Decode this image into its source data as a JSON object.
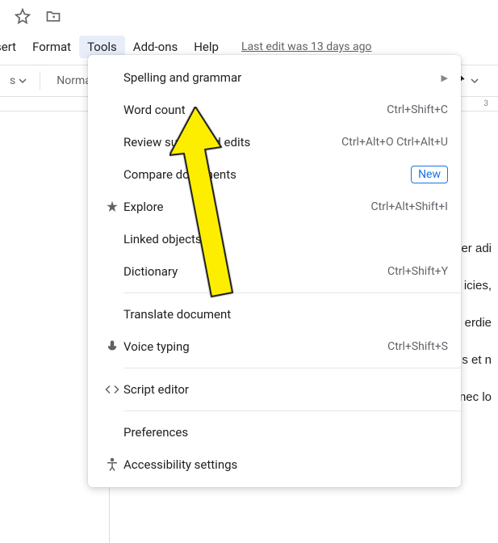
{
  "topIcons": {
    "star": "star-outline",
    "folder": "move-folder"
  },
  "menubar": {
    "items": [
      "sert",
      "Format",
      "Tools",
      "Add-ons",
      "Help"
    ],
    "activeIndex": 2,
    "lastEdit": "Last edit was 13 days ago"
  },
  "toolbar": {
    "styleDropdown": "Normal"
  },
  "ruler": {
    "marks": [
      "3"
    ]
  },
  "toolsMenu": {
    "items": [
      {
        "label": "Spelling and grammar",
        "icon": "",
        "shortcut": "",
        "submenu": true
      },
      {
        "label": "Word count",
        "icon": "",
        "shortcut": "Ctrl+Shift+C"
      },
      {
        "label": "Review suggested edits",
        "icon": "",
        "shortcut": "Ctrl+Alt+O Ctrl+Alt+U"
      },
      {
        "label": "Compare documents",
        "icon": "",
        "badge": "New"
      },
      {
        "label": "Explore",
        "icon": "explore",
        "shortcut": "Ctrl+Alt+Shift+I"
      },
      {
        "label": "Linked objects",
        "icon": ""
      },
      {
        "label": "Dictionary",
        "icon": "",
        "shortcut": "Ctrl+Shift+Y"
      },
      {
        "separator": true
      },
      {
        "label": "Translate document",
        "icon": ""
      },
      {
        "label": "Voice typing",
        "icon": "mic",
        "shortcut": "Ctrl+Shift+S"
      },
      {
        "separator": true
      },
      {
        "label": "Script editor",
        "icon": "code"
      },
      {
        "separator": true
      },
      {
        "label": "Preferences",
        "icon": ""
      },
      {
        "label": "Accessibility settings",
        "icon": "accessibility"
      }
    ]
  },
  "documentText": {
    "line1": "er adi",
    "line2": "icies,",
    "line3": "erdie",
    "line4": "s et n",
    "line5": "nec lo"
  }
}
